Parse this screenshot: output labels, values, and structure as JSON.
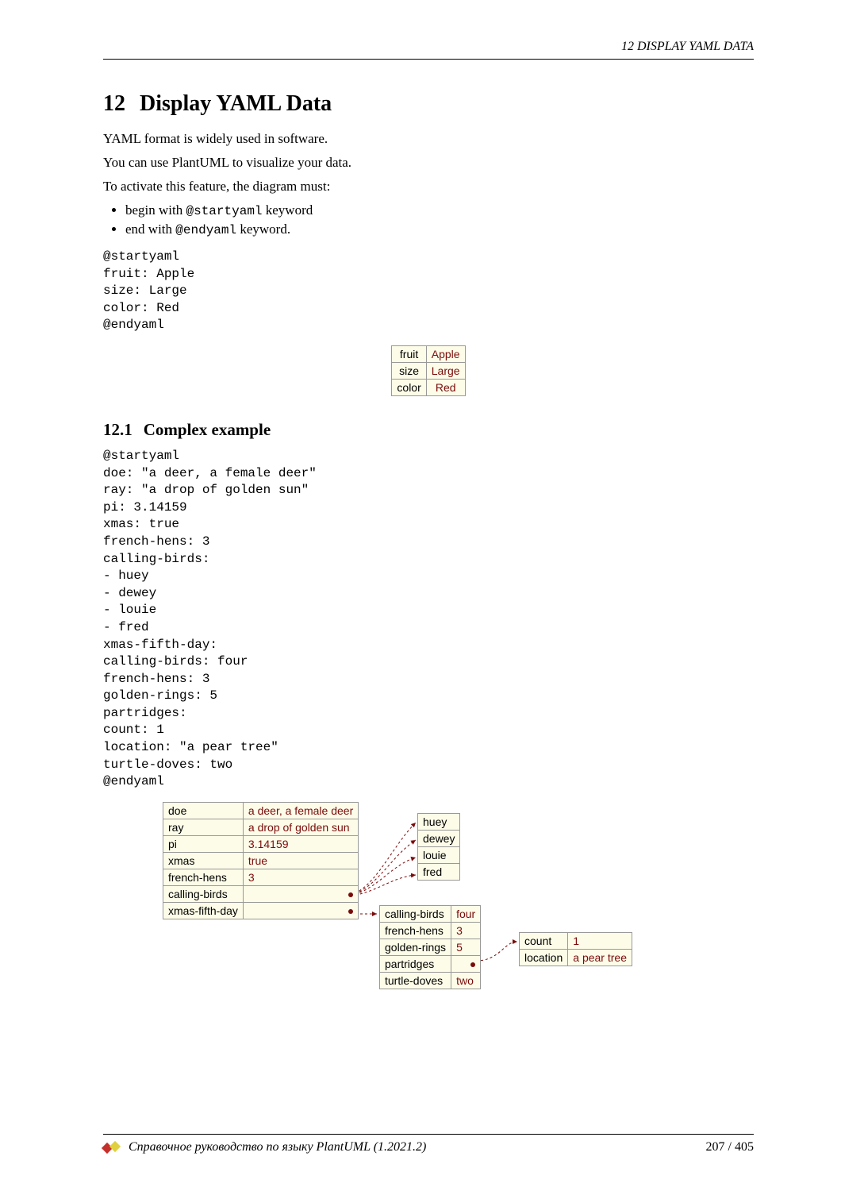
{
  "header": {
    "running": "12   DISPLAY YAML DATA"
  },
  "section": {
    "number": "12",
    "title": "Display YAML Data"
  },
  "intro": {
    "p1": "YAML format is widely used in software.",
    "p2": "You can use PlantUML to visualize your data.",
    "p3": "To activate this feature, the diagram must:",
    "li1_pre": "begin with ",
    "li1_code": "@startyaml",
    "li1_post": " keyword",
    "li2_pre": "end with ",
    "li2_code": "@endyaml",
    "li2_post": " keyword."
  },
  "code1": "@startyaml\nfruit: Apple\nsize: Large\ncolor: Red\n@endyaml",
  "table1": {
    "rows": [
      {
        "k": "fruit",
        "v": "Apple"
      },
      {
        "k": "size",
        "v": "Large"
      },
      {
        "k": "color",
        "v": "Red"
      }
    ]
  },
  "subsection": {
    "number": "12.1",
    "title": "Complex example"
  },
  "code2": "@startyaml\ndoe: \"a deer, a female deer\"\nray: \"a drop of golden sun\"\npi: 3.14159\nxmas: true\nfrench-hens: 3\ncalling-birds:\n- huey\n- dewey\n- louie\n- fred\nxmas-fifth-day:\ncalling-birds: four\nfrench-hens: 3\ngolden-rings: 5\npartridges:\ncount: 1\nlocation: \"a pear tree\"\nturtle-doves: two\n@endyaml",
  "diagram2": {
    "root": [
      {
        "k": "doe",
        "v": "a deer, a female deer"
      },
      {
        "k": "ray",
        "v": "a drop of golden sun"
      },
      {
        "k": "pi",
        "v": "3.14159"
      },
      {
        "k": "xmas",
        "v": "true"
      },
      {
        "k": "french-hens",
        "v": "3"
      },
      {
        "k": "calling-birds",
        "v": ""
      },
      {
        "k": "xmas-fifth-day",
        "v": ""
      }
    ],
    "birds": [
      {
        "v": "huey"
      },
      {
        "v": "dewey"
      },
      {
        "v": "louie"
      },
      {
        "v": "fred"
      }
    ],
    "fifth": [
      {
        "k": "calling-birds",
        "v": "four"
      },
      {
        "k": "french-hens",
        "v": "3"
      },
      {
        "k": "golden-rings",
        "v": "5"
      },
      {
        "k": "partridges",
        "v": ""
      },
      {
        "k": "turtle-doves",
        "v": "two"
      }
    ],
    "partridges": [
      {
        "k": "count",
        "v": "1"
      },
      {
        "k": "location",
        "v": "a pear tree"
      }
    ]
  },
  "footer": {
    "title": "Справочное руководство по языку PlantUML (1.2021.2)",
    "page": "207 / 405"
  },
  "chart_data": {
    "type": "table",
    "description": "PlantUML YAML visualizations shown as linked key/value tables",
    "simple_example": {
      "fruit": "Apple",
      "size": "Large",
      "color": "Red"
    },
    "complex_example": {
      "doe": "a deer, a female deer",
      "ray": "a drop of golden sun",
      "pi": 3.14159,
      "xmas": true,
      "french-hens": 3,
      "calling-birds": [
        "huey",
        "dewey",
        "louie",
        "fred"
      ],
      "xmas-fifth-day": {
        "calling-birds": "four",
        "french-hens": 3,
        "golden-rings": 5,
        "partridges": {
          "count": 1,
          "location": "a pear tree"
        },
        "turtle-doves": "two"
      }
    }
  }
}
